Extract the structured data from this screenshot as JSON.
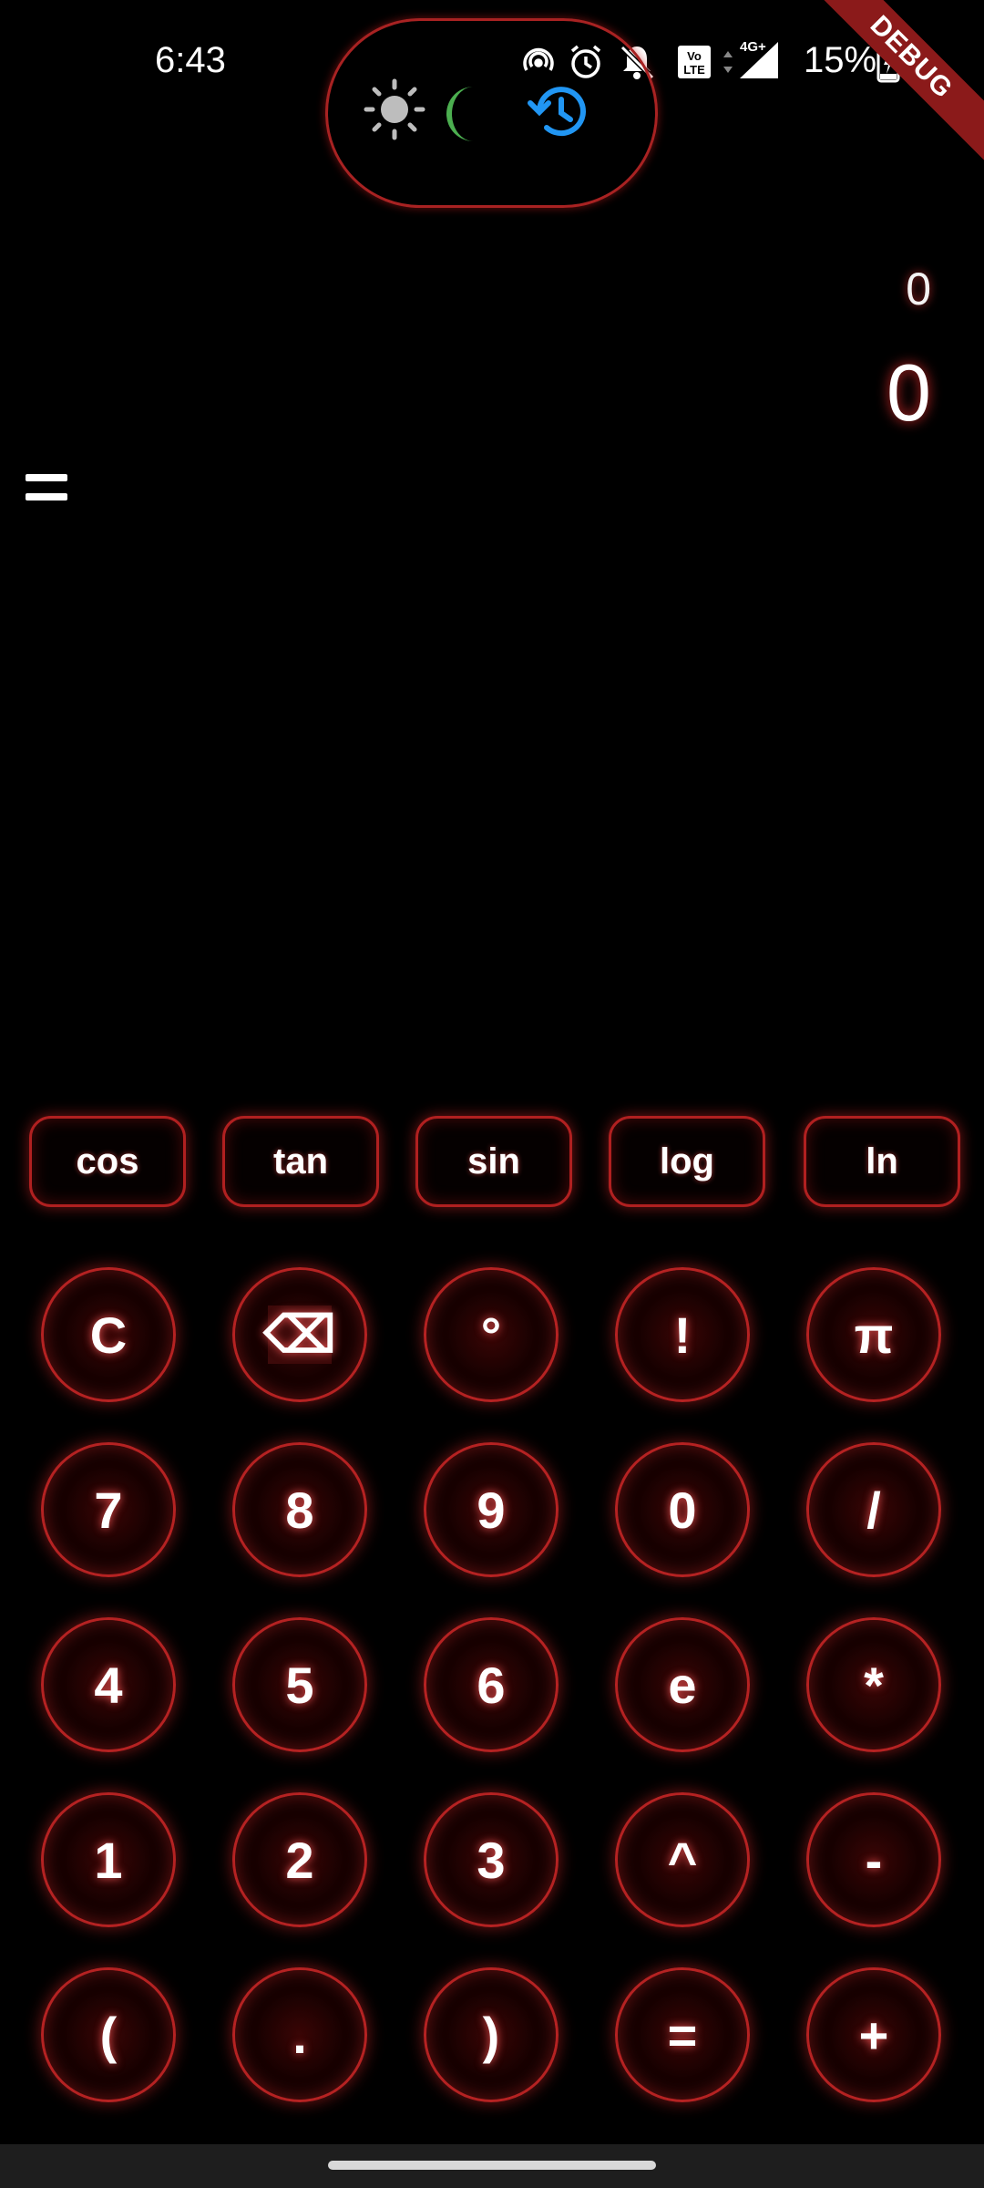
{
  "status_bar": {
    "time": "6:43",
    "battery": "15%",
    "icons": [
      "hotspot-icon",
      "alarm-icon",
      "bell-off-icon",
      "volte-icon",
      "data-arrows-icon",
      "signal-4g-icon",
      "battery-charging-icon"
    ],
    "network_label": "4G+",
    "volte_label": "Vo LTE"
  },
  "debug_banner": "DEBUG",
  "theme_switcher": {
    "icons": [
      "sun-icon",
      "moon-icon",
      "history-icon"
    ],
    "colors": {
      "sun": "#bdbdbd",
      "moon": "#4caf50",
      "history": "#2196f3"
    }
  },
  "display": {
    "expression": "0",
    "result": "0"
  },
  "menu": {
    "icon": "menu-icon"
  },
  "scientific": [
    "cos",
    "tan",
    "sin",
    "log",
    "ln"
  ],
  "keypad": [
    [
      "C",
      "⌫",
      "°",
      "!",
      "π"
    ],
    [
      "7",
      "8",
      "9",
      "0",
      "/"
    ],
    [
      "4",
      "5",
      "6",
      "e",
      "*"
    ],
    [
      "1",
      "2",
      "3",
      "^",
      "-"
    ],
    [
      "(",
      ".",
      ")",
      "=",
      "+"
    ]
  ],
  "accent_color": "#b52222"
}
